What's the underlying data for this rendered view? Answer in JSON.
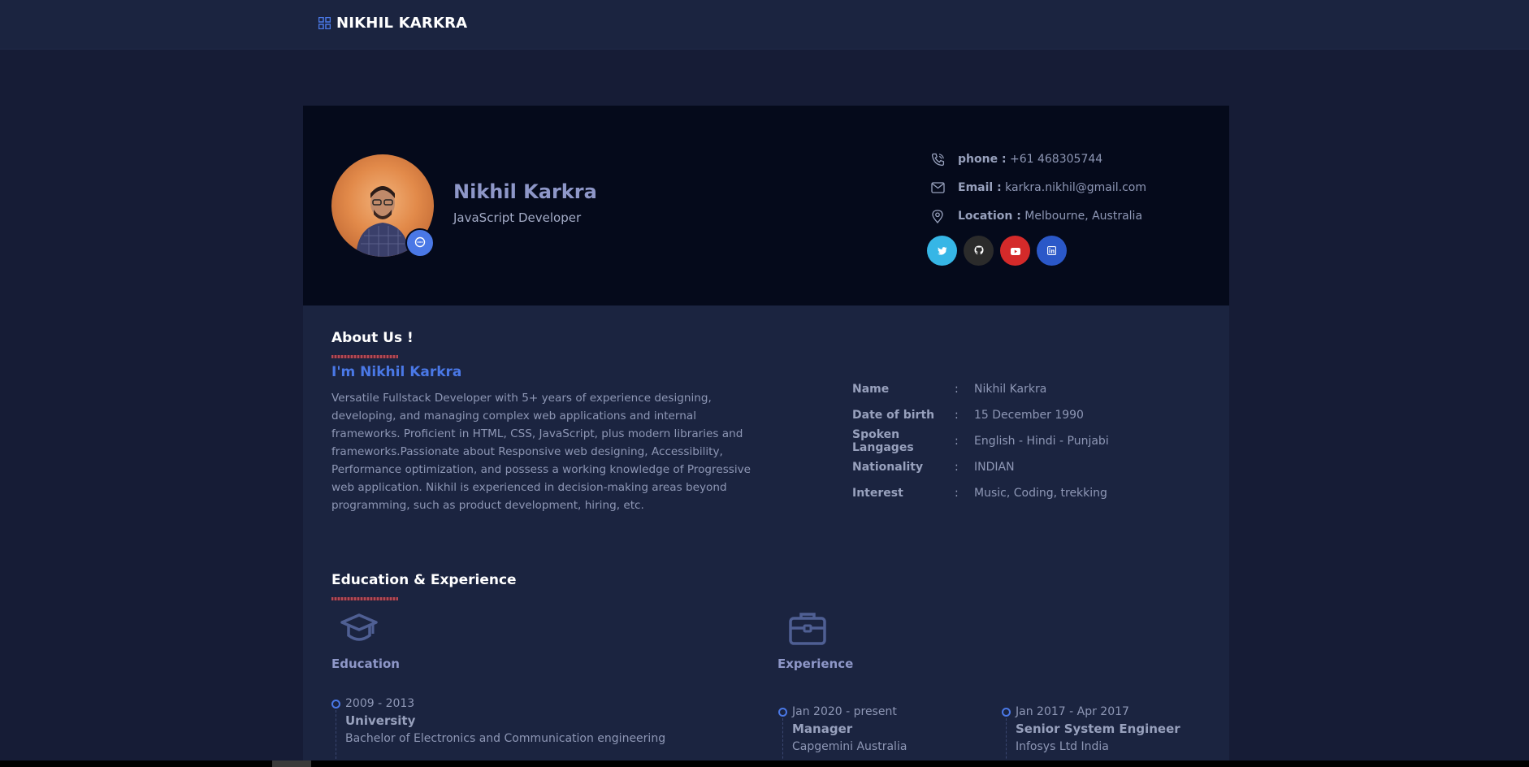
{
  "header": {
    "brand": "NIKHIL KARKRA",
    "brand_icon": "grid-icon"
  },
  "profile": {
    "name": "Nikhil Karkra",
    "role": "JavaScript Developer",
    "contacts": [
      {
        "icon": "phone-icon",
        "label": "phone :",
        "value": "+61 468305744"
      },
      {
        "icon": "mail-icon",
        "label": "Email :",
        "value": "karkra.nikhil@gmail.com"
      },
      {
        "icon": "location-icon",
        "label": "Location :",
        "value": "Melbourne, Australia"
      }
    ],
    "socials": [
      {
        "name": "twitter",
        "color": "#36b6e6"
      },
      {
        "name": "github",
        "color": "#2b2b2b"
      },
      {
        "name": "youtube",
        "color": "#d42a2a"
      },
      {
        "name": "linkedin",
        "color": "#2b58c8"
      }
    ]
  },
  "about": {
    "title": "About Us !",
    "heading": "I'm Nikhil Karkra",
    "text": "Versatile Fullstack Developer with 5+ years of experience designing, developing, and managing complex web applications and internal frameworks. Proficient in HTML, CSS, JavaScript, plus modern libraries and frameworks.Passionate about Responsive web designing, Accessibility, Performance optimization, and possess a working knowledge of Progressive web application. Nikhil is experienced in decision-making areas beyond programming, such as product development, hiring, etc.",
    "details": [
      {
        "key": "Name",
        "value": "Nikhil Karkra"
      },
      {
        "key": "Date of birth",
        "value": "15 December 1990"
      },
      {
        "key": "Spoken Langages",
        "value": "English - Hindi - Punjabi"
      },
      {
        "key": "Nationality",
        "value": "INDIAN"
      },
      {
        "key": "Interest",
        "value": "Music, Coding, trekking"
      }
    ]
  },
  "education_experience": {
    "title": "Education & Experience",
    "education_title": "Education",
    "experience_title": "Experience",
    "education": [
      {
        "date": "2009 - 2013",
        "title": "University",
        "subtitle": "Bachelor of Electronics and Communication engineering"
      }
    ],
    "experience": [
      {
        "date": "Jan 2020 - present",
        "title": "Manager",
        "subtitle": "Capgemini Australia"
      },
      {
        "date": "Jan 2017 - Apr 2017",
        "title": "Senior System Engineer",
        "subtitle": "Infosys Ltd India"
      }
    ]
  },
  "colors": {
    "accent": "#4a78e6",
    "background": "#161c36",
    "card": "#1b2440",
    "hero": "#050a1b"
  }
}
